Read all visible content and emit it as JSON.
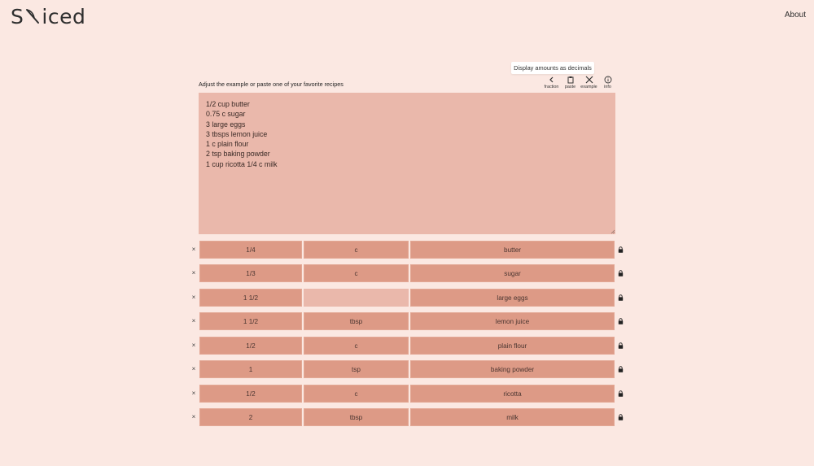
{
  "header": {
    "logo": "Sliced",
    "logo_left": "S",
    "logo_right": "iced",
    "about_link": "About"
  },
  "tooltip": "Display amounts as decimals",
  "instructions": "Adjust the example or paste one of your favorite recipes",
  "toolbar": {
    "fraction": "fraction",
    "paste": "paste",
    "example": "example",
    "info": "info"
  },
  "recipe_text": "1/2 cup butter\n0.75 c sugar\n3 large eggs\n3 tbsps lemon juice\n1 c plain flour\n2 tsp baking powder\n1 cup ricotta 1/4 c milk",
  "ingredients": [
    {
      "amount": "1/4",
      "unit": "c",
      "name": "butter"
    },
    {
      "amount": "1/3",
      "unit": "c",
      "name": "sugar"
    },
    {
      "amount": "1 1/2",
      "unit": "",
      "name": "large eggs"
    },
    {
      "amount": "1 1/2",
      "unit": "tbsp",
      "name": "lemon juice"
    },
    {
      "amount": "1/2",
      "unit": "c",
      "name": "plain flour"
    },
    {
      "amount": "1",
      "unit": "tsp",
      "name": "baking powder"
    },
    {
      "amount": "1/2",
      "unit": "c",
      "name": "ricotta"
    },
    {
      "amount": "2",
      "unit": "tbsp",
      "name": "milk"
    }
  ],
  "remove_symbol": "×",
  "colors": {
    "background": "#fbe8e2",
    "textarea": "#eab8ab",
    "cell": "#dd9a86"
  }
}
